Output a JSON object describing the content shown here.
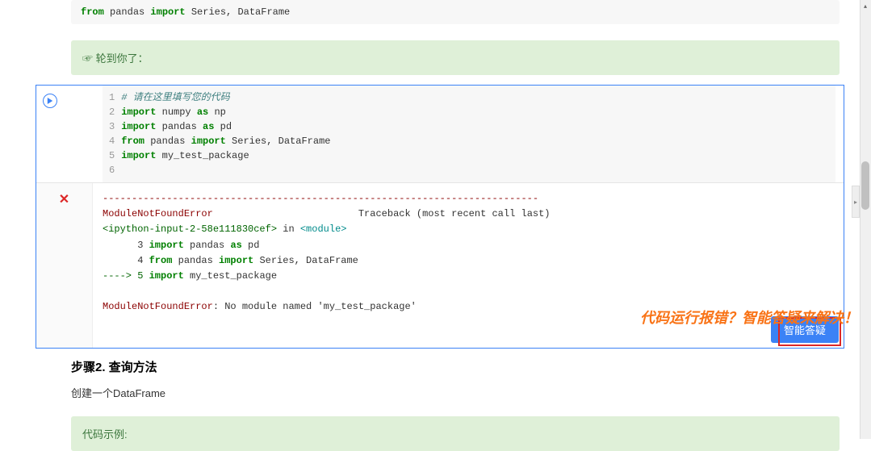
{
  "top_code": {
    "line": "from pandas import Series, DataFrame"
  },
  "banner1": {
    "text": "☞ 轮到你了："
  },
  "code_cell": {
    "lines": [
      {
        "n": "1",
        "type": "comment",
        "text": "# 请在这里填写您的代码"
      },
      {
        "n": "2",
        "type": "code",
        "tokens": [
          "import",
          " numpy ",
          "as",
          " np"
        ]
      },
      {
        "n": "3",
        "type": "code",
        "tokens": [
          "import",
          " pandas ",
          "as",
          " pd"
        ]
      },
      {
        "n": "4",
        "type": "code",
        "tokens": [
          "from",
          " pandas ",
          "import",
          " Series, DataFrame"
        ]
      },
      {
        "n": "5",
        "type": "code",
        "tokens": [
          "import",
          " my_test_package"
        ]
      },
      {
        "n": "6",
        "type": "code",
        "tokens": [
          ""
        ]
      }
    ]
  },
  "traceback": {
    "divider": "---------------------------------------------------------------------------",
    "error_header_name": "ModuleNotFoundError",
    "error_header_rest": "                         Traceback (most recent call last)",
    "location_pre": "<ipython-input-2-58e111830cef>",
    "location_mid": " in ",
    "location_mod": "<module>",
    "line3": "      3 import pandas as pd",
    "line3_n": "      3 ",
    "line3_kw1": "import",
    "line3_txt": " pandas ",
    "line3_kw2": "as",
    "line3_txt2": " pd",
    "line4_n": "      4 ",
    "line4_kw1": "from",
    "line4_txt": " pandas ",
    "line4_kw2": "import",
    "line4_txt2": " Series, DataFrame",
    "line5_arrow": "----> 5 ",
    "line5_kw": "import",
    "line5_txt": " my_test_package",
    "final_name": "ModuleNotFoundError",
    "final_msg": ": No module named 'my_test_package'"
  },
  "smart_qa_label": "智能答疑",
  "annotation": "代码运行报错？智能答疑来解决！",
  "step2": {
    "heading": "步骤2. 查询方法",
    "text": "创建一个DataFrame"
  },
  "banner2": {
    "text": "代码示例:"
  }
}
